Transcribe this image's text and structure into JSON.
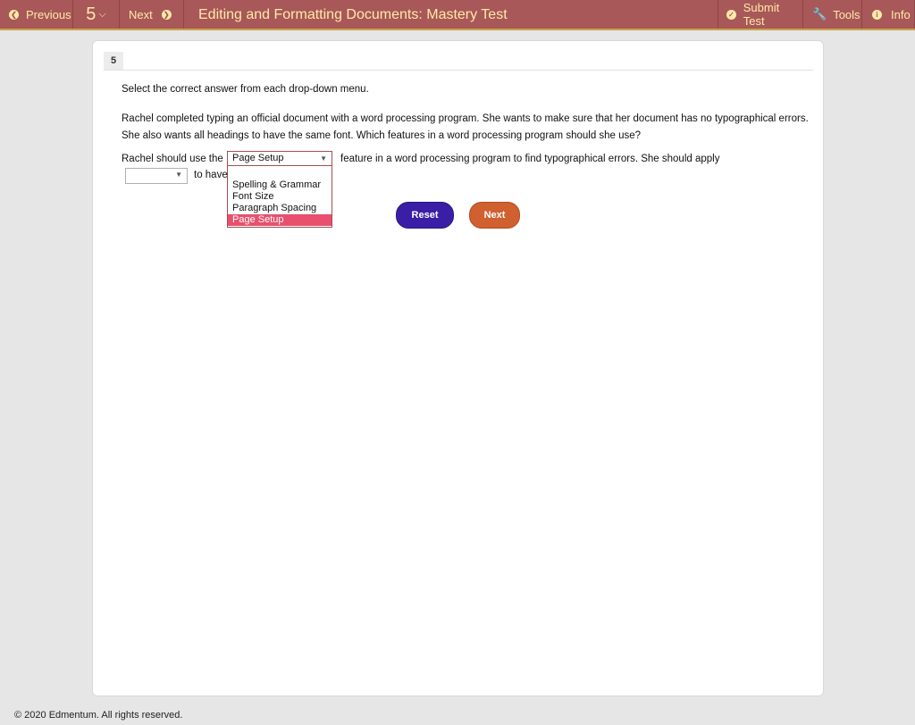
{
  "topbar": {
    "previous_label": "Previous",
    "question_number": "5",
    "next_label": "Next",
    "title": "Editing and Formatting Documents: Mastery Test",
    "submit_label": "Submit Test",
    "tools_label": "Tools",
    "info_label": "Info"
  },
  "question": {
    "tab_label": "5",
    "instruction": "Select the correct answer from each drop-down menu.",
    "paragraph_line1": "Rachel completed typing an official document with a word processing program. She wants to make sure that her document has no typographical errors.",
    "paragraph_line2": "She also wants all headings to have the same font. Which features in a word processing program should she use?",
    "sentence_lead": "Rachel should use the",
    "sentence_after_first": "feature in a word processing program to find typographical errors. She should apply",
    "sentence_tail": "to have",
    "dropdown1": {
      "selected": "Page Setup",
      "options": [
        "Spelling & Grammar",
        "Font Size",
        "Paragraph Spacing",
        "Page Setup"
      ],
      "highlighted_index": 3
    },
    "dropdown2": {
      "selected": ""
    }
  },
  "buttons": {
    "reset_label": "Reset",
    "next_label": "Next"
  },
  "footer": {
    "copyright": "© 2020 Edmentum. All rights reserved."
  },
  "colors": {
    "topbar_bg": "#a85858",
    "topbar_text": "#ffe9a8",
    "reset_button": "#3a1fa6",
    "next_button": "#d06030",
    "highlight_option": "#e8506e"
  }
}
